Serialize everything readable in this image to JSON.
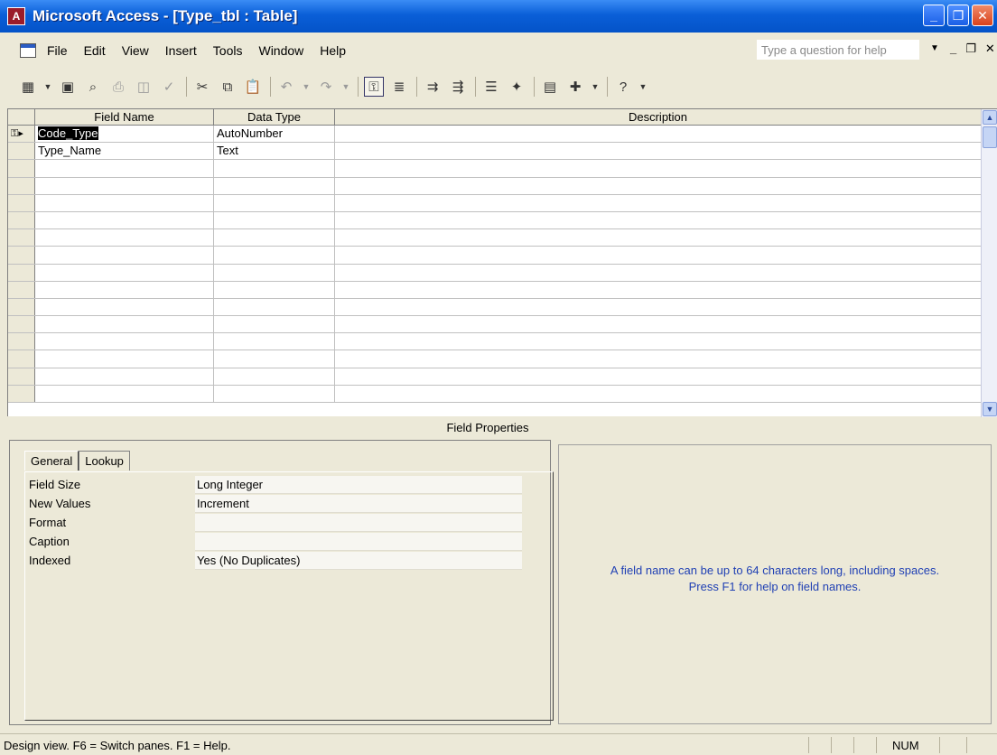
{
  "window": {
    "title": "Microsoft Access - [Type_tbl : Table]",
    "buttons": [
      "_",
      "❐",
      "✕"
    ]
  },
  "menubar": {
    "items": [
      "File",
      "Edit",
      "View",
      "Insert",
      "Tools",
      "Window",
      "Help"
    ],
    "help_placeholder": "Type a question for help",
    "mdi_buttons": [
      "_",
      "❐",
      "✕"
    ]
  },
  "toolbar": {
    "icons": [
      "view-icon",
      "save-icon",
      "search-icon",
      "print-icon",
      "print-preview-icon",
      "spelling-icon",
      "cut-icon",
      "copy-icon",
      "paste-icon",
      "undo-icon",
      "redo-icon",
      "primary-key-icon",
      "indexes-icon",
      "insert-rows-icon",
      "delete-rows-icon",
      "properties-icon",
      "builder-icon",
      "database-window-icon",
      "new-object-icon",
      "help-icon"
    ]
  },
  "grid": {
    "columns": [
      "Field Name",
      "Data Type",
      "Description"
    ],
    "rows": [
      {
        "field_name": "Code_Type",
        "data_type": "AutoNumber",
        "description": ""
      },
      {
        "field_name": "Type_Name",
        "data_type": "Text",
        "description": ""
      }
    ]
  },
  "field_properties": {
    "label": "Field Properties",
    "tabs": [
      "General",
      "Lookup"
    ],
    "active_tab": "General",
    "rows": [
      {
        "name": "Field Size",
        "value": "Long Integer"
      },
      {
        "name": "New Values",
        "value": "Increment"
      },
      {
        "name": "Format",
        "value": ""
      },
      {
        "name": "Caption",
        "value": ""
      },
      {
        "name": "Indexed",
        "value": "Yes (No Duplicates)"
      }
    ],
    "hint_line1": "A field name can be up to 64 characters long, including spaces.",
    "hint_line2": "Press F1 for help on field names."
  },
  "statusbar": {
    "text": "Design view.  F6 = Switch panes.  F1 = Help.",
    "num": "NUM"
  }
}
